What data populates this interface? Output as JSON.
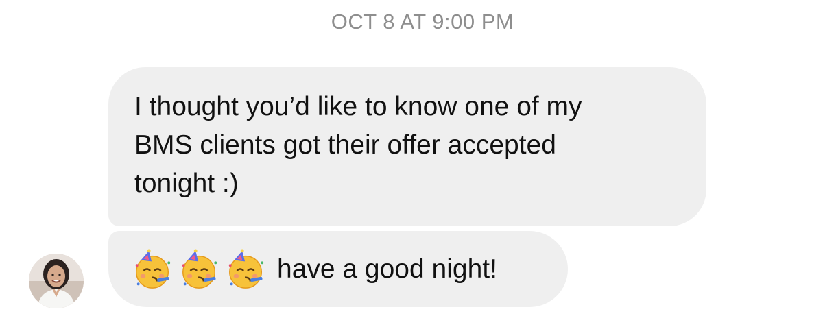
{
  "thread": {
    "timestamp": "OCT 8 AT 9:00 PM",
    "messages": [
      {
        "text": "I thought you’d like to know one of my\nBMS clients got their offer accepted\ntonight :)"
      },
      {
        "emojis": [
          "partying-face-emoji",
          "partying-face-emoji",
          "partying-face-emoji"
        ],
        "text": "have a good night!"
      }
    ],
    "sender": {
      "avatar_icon": "profile-photo-avatar"
    }
  },
  "colors": {
    "bubble_background": "#efefef",
    "timestamp_text": "#8e8e8e",
    "message_text": "#111111"
  }
}
